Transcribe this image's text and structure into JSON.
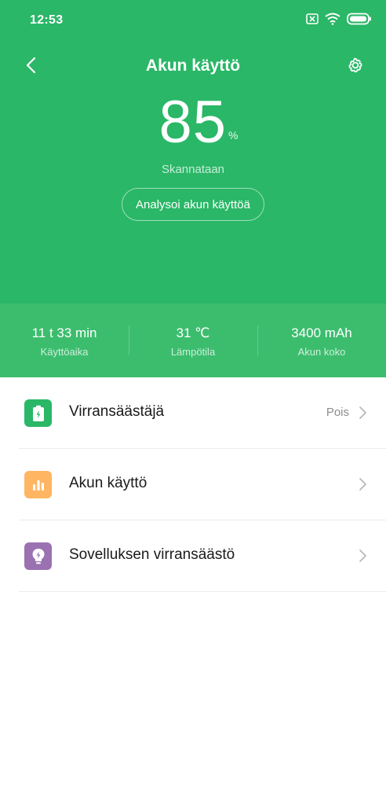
{
  "status_bar": {
    "time": "12:53",
    "icons": [
      "sim-off-icon",
      "wifi-icon",
      "battery-icon"
    ]
  },
  "header": {
    "title": "Akun käyttö",
    "back_icon": "back-arrow-icon",
    "settings_icon": "gear-icon"
  },
  "battery": {
    "percent": "85",
    "percent_sign": "%",
    "status": "Skannataan",
    "analyze_button": "Analysoi akun käyttöä"
  },
  "stats": [
    {
      "value": "11 t 33 min",
      "label": "Käyttöaika"
    },
    {
      "value": "31 ℃",
      "label": "Lämpötila"
    },
    {
      "value": "3400 mAh",
      "label": "Akun koko"
    }
  ],
  "list": [
    {
      "label": "Virransäästäjä",
      "value": "Pois",
      "icon": "battery-saver-icon",
      "icon_color": "#2ab767"
    },
    {
      "label": "Akun käyttö",
      "value": "",
      "icon": "bar-chart-icon",
      "icon_color": "#ffb562"
    },
    {
      "label": "Sovelluksen virransäästö",
      "value": "",
      "icon": "lightbulb-bolt-icon",
      "icon_color": "#9a72b1"
    }
  ],
  "colors": {
    "primary_green": "#2ab767",
    "stats_green": "#3cbd6e"
  }
}
